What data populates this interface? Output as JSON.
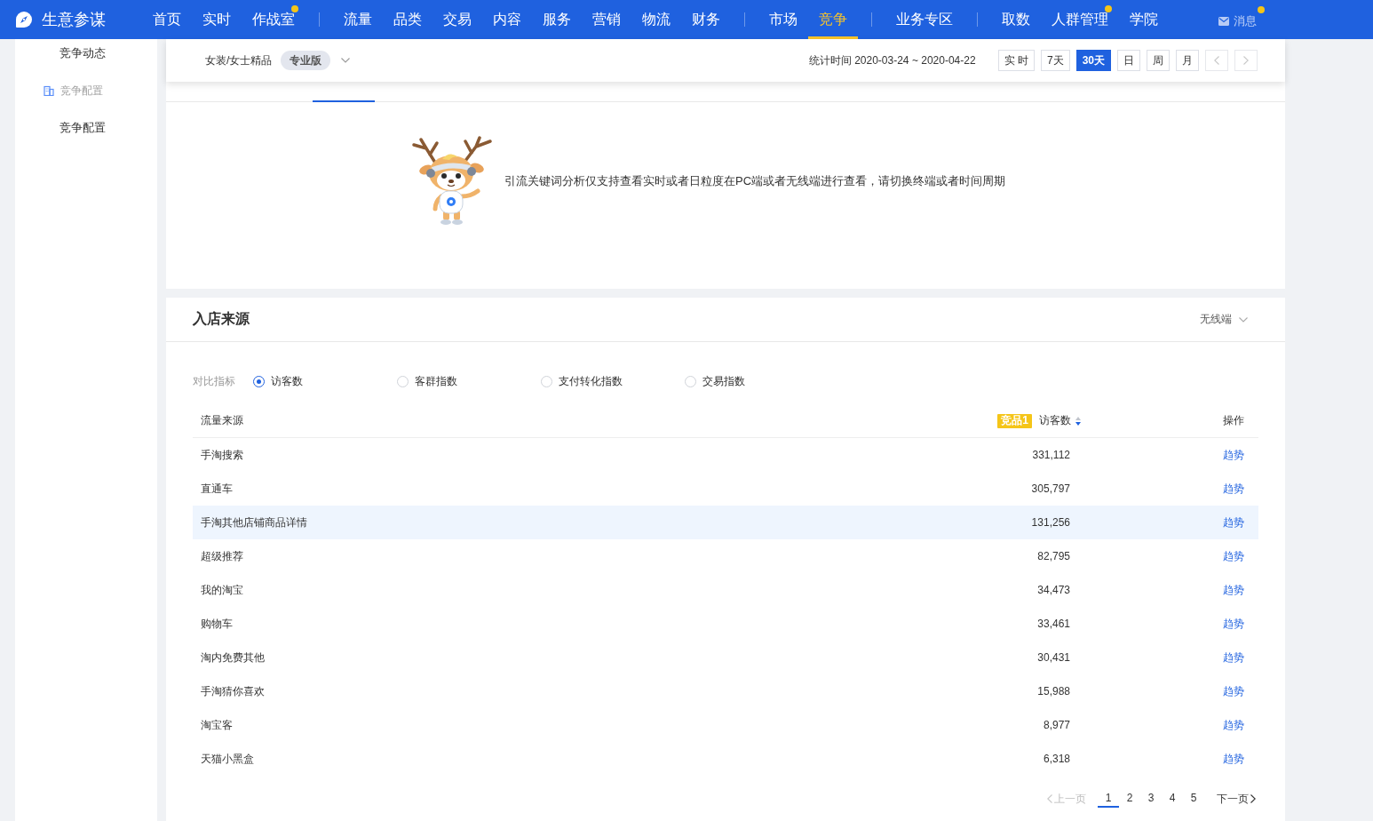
{
  "top_nav": {
    "logo": "生意参谋",
    "groups": [
      [
        {
          "label": "首页",
          "selected": false,
          "dot": false
        },
        {
          "label": "实时",
          "selected": false,
          "dot": false
        },
        {
          "label": "作战室",
          "selected": false,
          "dot": true
        }
      ],
      [
        {
          "label": "流量",
          "selected": false,
          "dot": false
        },
        {
          "label": "品类",
          "selected": false,
          "dot": false
        },
        {
          "label": "交易",
          "selected": false,
          "dot": false
        },
        {
          "label": "内容",
          "selected": false,
          "dot": false
        },
        {
          "label": "服务",
          "selected": false,
          "dot": false
        },
        {
          "label": "营销",
          "selected": false,
          "dot": false
        },
        {
          "label": "物流",
          "selected": false,
          "dot": false
        },
        {
          "label": "财务",
          "selected": false,
          "dot": false
        }
      ],
      [
        {
          "label": "市场",
          "selected": false,
          "dot": false
        },
        {
          "label": "竞争",
          "selected": true,
          "dot": false
        }
      ],
      [
        {
          "label": "业务专区",
          "selected": false,
          "dot": false
        }
      ],
      [
        {
          "label": "取数",
          "selected": false,
          "dot": false
        },
        {
          "label": "人群管理",
          "selected": false,
          "dot": true
        },
        {
          "label": "学院",
          "selected": false,
          "dot": false
        }
      ]
    ],
    "messages": {
      "label": "消息",
      "dot": true
    }
  },
  "sidebar": {
    "items": [
      {
        "kind": "item",
        "label": "竞争动态"
      },
      {
        "kind": "section",
        "label": "竞争配置"
      },
      {
        "kind": "item",
        "label": "竞争配置"
      }
    ]
  },
  "filter_bar": {
    "category": "女装/女士精品",
    "edition_badge": "专业版",
    "stat_period": "统计时间 2020-03-24 ~ 2020-04-22",
    "ranges": [
      {
        "label": "实 时",
        "selected": false
      },
      {
        "label": "7天",
        "selected": false
      },
      {
        "label": "30天",
        "selected": true
      },
      {
        "label": "日",
        "selected": false
      },
      {
        "label": "周",
        "selected": false
      },
      {
        "label": "月",
        "selected": false
      }
    ],
    "pagers": [
      {
        "kind": "prev",
        "disabled": true
      },
      {
        "kind": "next",
        "disabled": true
      }
    ]
  },
  "keyword_card": {
    "notice": "引流关键词分析仅支持查看实时或者日粒度在PC端或者无线端进行查看，请切换终端或者时间周期"
  },
  "source_card": {
    "title": "入店来源",
    "device": "无线端",
    "metric_label": "对比指标",
    "metrics": [
      {
        "label": "访客数",
        "selected": true
      },
      {
        "label": "客群指数",
        "selected": false
      },
      {
        "label": "支付转化指数",
        "selected": false
      },
      {
        "label": "交易指数",
        "selected": false
      }
    ],
    "table": {
      "columns": [
        {
          "kind": "text",
          "label": "流量来源"
        },
        {
          "kind": "metric",
          "badge": "竞品1",
          "label": "访客数",
          "sorted_descending": true
        },
        {
          "kind": "action",
          "label": "操作"
        }
      ],
      "rows": [
        {
          "source": "手淘搜索",
          "value": "331,112",
          "action": "趋势",
          "highlighted": false
        },
        {
          "source": "直通车",
          "value": "305,797",
          "action": "趋势",
          "highlighted": false
        },
        {
          "source": "手淘其他店铺商品详情",
          "value": "131,256",
          "action": "趋势",
          "highlighted": true
        },
        {
          "source": "超级推荐",
          "value": "82,795",
          "action": "趋势",
          "highlighted": false
        },
        {
          "source": "我的淘宝",
          "value": "34,473",
          "action": "趋势",
          "highlighted": false
        },
        {
          "source": "购物车",
          "value": "33,461",
          "action": "趋势",
          "highlighted": false
        },
        {
          "source": "淘内免费其他",
          "value": "30,431",
          "action": "趋势",
          "highlighted": false
        },
        {
          "source": "手淘猜你喜欢",
          "value": "15,988",
          "action": "趋势",
          "highlighted": false
        },
        {
          "source": "淘宝客",
          "value": "8,977",
          "action": "趋势",
          "highlighted": false
        },
        {
          "source": "天猫小黑盒",
          "value": "6,318",
          "action": "趋势",
          "highlighted": false
        }
      ]
    },
    "pagination": {
      "prev": {
        "label": "上一页",
        "disabled": true
      },
      "pages": [
        {
          "label": "1",
          "selected": true
        },
        {
          "label": "2",
          "selected": false
        },
        {
          "label": "3",
          "selected": false
        },
        {
          "label": "4",
          "selected": false
        },
        {
          "label": "5",
          "selected": false
        }
      ],
      "next": {
        "label": "下一页",
        "disabled": false
      }
    }
  }
}
